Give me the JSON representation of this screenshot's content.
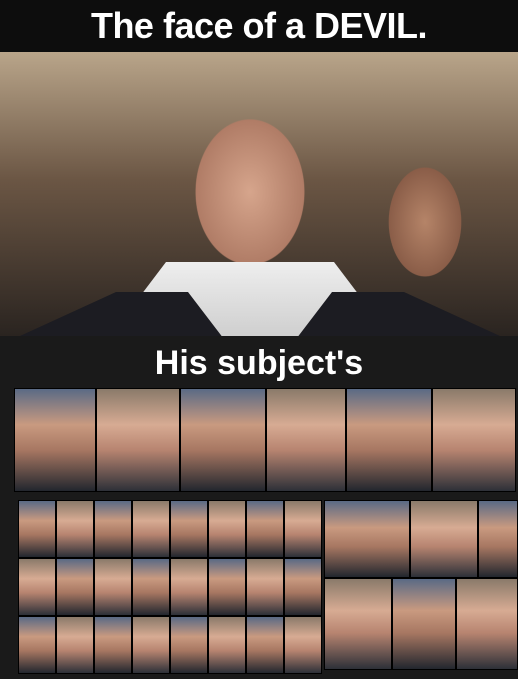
{
  "title": "The face of a DEVIL.",
  "subtitle": "His subject's",
  "portraits": {
    "large_row": 6,
    "small_grid": {
      "rows": 3,
      "cols": 8
    },
    "right_tiles": 6
  }
}
